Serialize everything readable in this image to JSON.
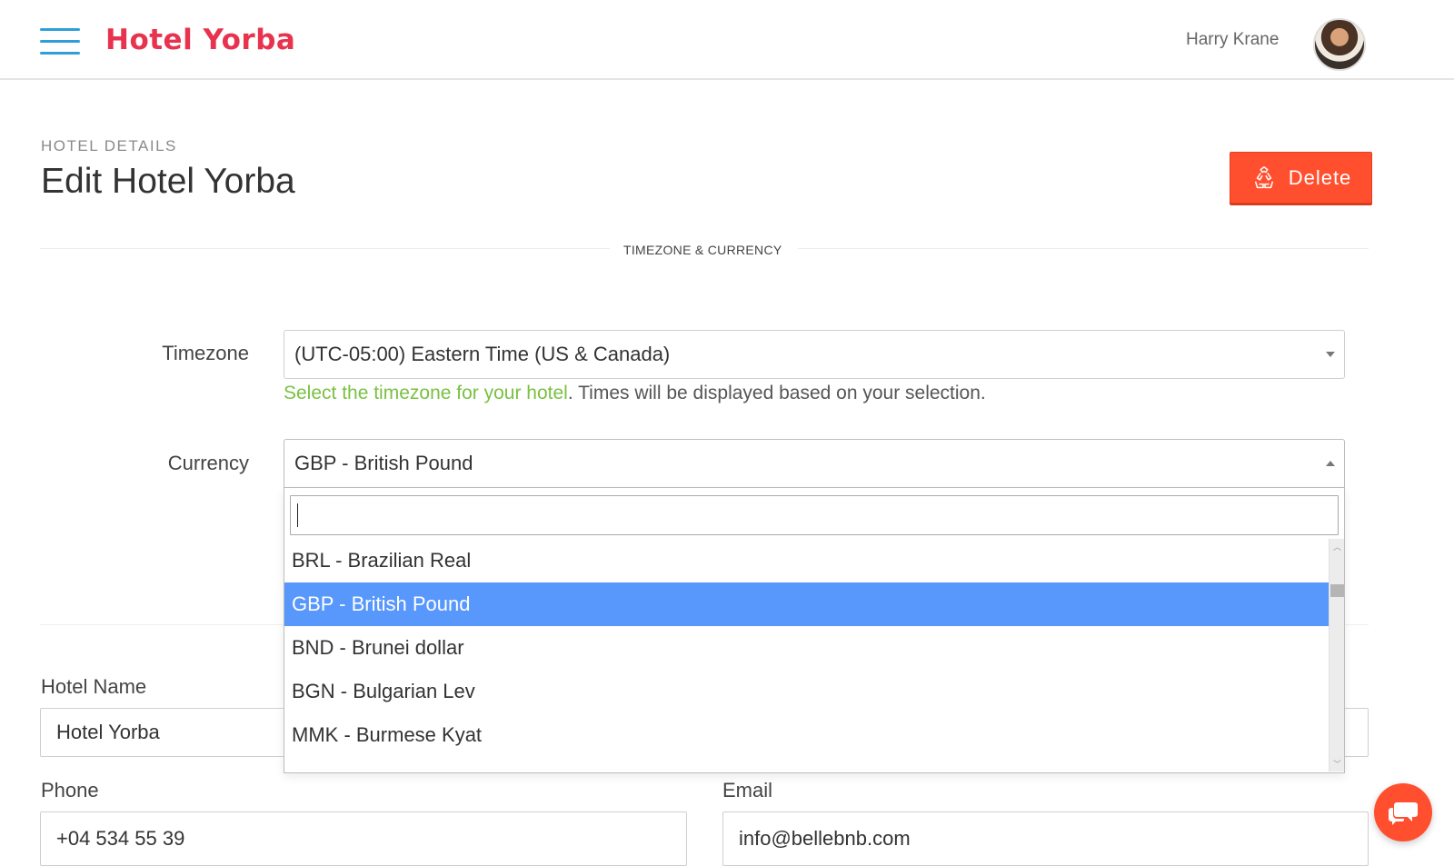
{
  "header": {
    "brand": "Hotel Yorba",
    "user_name": "Harry Krane"
  },
  "page": {
    "breadcrumb": "HOTEL DETAILS",
    "title": "Edit Hotel Yorba",
    "delete_label": "Delete"
  },
  "section": {
    "title": "TIMEZONE & CURRENCY"
  },
  "timezone": {
    "label": "Timezone",
    "value": "(UTC-05:00) Eastern Time (US & Canada)",
    "help_highlight": "Select the timezone for your hotel",
    "help_rest": ". Times will be displayed based on your selection."
  },
  "currency": {
    "label": "Currency",
    "value": "GBP - British Pound",
    "search_value": "",
    "options": [
      "BRL - Brazilian Real",
      "GBP - British Pound",
      "BND - Brunei dollar",
      "BGN - Bulgarian Lev",
      "MMK - Burmese Kyat"
    ],
    "selected_index": 1
  },
  "hotel_name": {
    "label": "Hotel Name",
    "value": "Hotel Yorba"
  },
  "phone": {
    "label": "Phone",
    "value": "+04 534 55 39"
  },
  "email": {
    "label": "Email",
    "value": "info@bellebnb.com"
  },
  "colors": {
    "brand": "#e8334f",
    "accent": "#ff4f2e",
    "menu": "#2f9fd8",
    "highlight_text": "#79c142",
    "selected_option": "#5897fb"
  }
}
